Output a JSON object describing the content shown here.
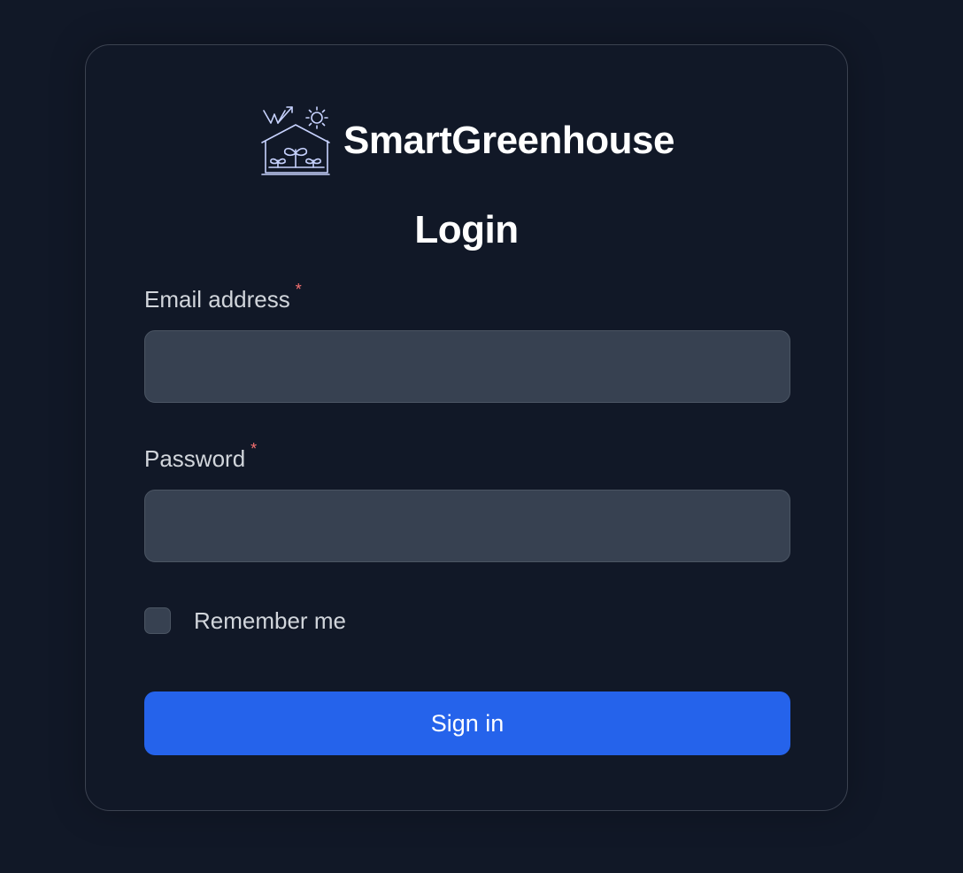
{
  "brand": {
    "name": "SmartGreenhouse",
    "logo_icon": "greenhouse-logo-icon",
    "logo_color": "#c7d2fe"
  },
  "login": {
    "title": "Login",
    "email": {
      "label": "Email address",
      "required_mark": "*",
      "value": "",
      "placeholder": ""
    },
    "password": {
      "label": "Password",
      "required_mark": "*",
      "value": "",
      "placeholder": ""
    },
    "remember": {
      "label": "Remember me",
      "checked": false
    },
    "submit_label": "Sign in"
  },
  "colors": {
    "background": "#111827",
    "input_bg": "#374151",
    "accent": "#2563eb",
    "required": "#f87171"
  }
}
